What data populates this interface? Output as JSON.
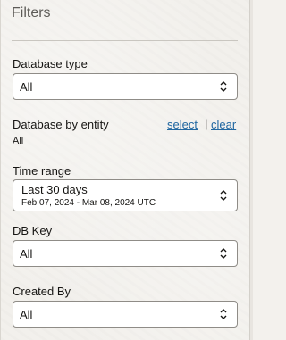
{
  "panel": {
    "title": "Filters"
  },
  "database_type": {
    "label": "Database type",
    "value": "All"
  },
  "database_by_entity": {
    "label": "Database by entity",
    "select_link": "select",
    "separator": "|",
    "clear_link": "clear",
    "value": "All"
  },
  "time_range": {
    "label": "Time range",
    "value": "Last 30 days",
    "sub_value": "Feb 07, 2024 - Mar 08, 2024 UTC"
  },
  "db_key": {
    "label": "DB Key",
    "value": "All"
  },
  "created_by": {
    "label": "Created By",
    "value": "All"
  },
  "colors": {
    "link": "#2167a1",
    "border": "#8f8c87",
    "background": "#f2f0ec"
  },
  "icons": {
    "select_chevron": "chevron-up-down-icon"
  }
}
